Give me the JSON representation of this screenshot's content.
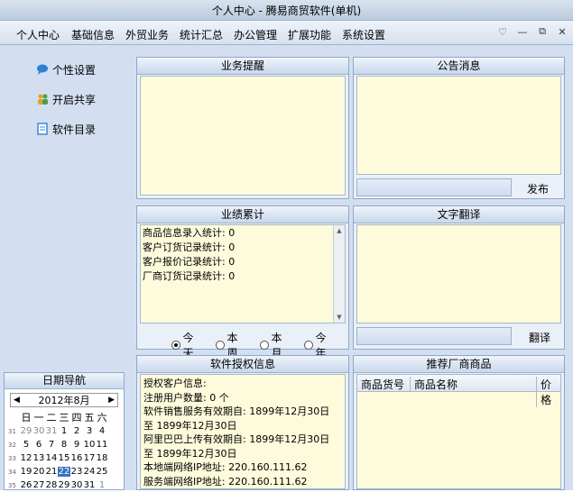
{
  "window": {
    "title": "个人中心 - 腾易商贸软件(单机)",
    "minimize": "—",
    "maximize": "▢",
    "close": "✕"
  },
  "menu": {
    "items": [
      "个人中心",
      "基础信息",
      "外贸业务",
      "统计汇总",
      "办公管理",
      "扩展功能",
      "系统设置"
    ],
    "right_icons": [
      "chevron-down-icon",
      "minimize-icon",
      "restore-icon",
      "close-icon"
    ],
    "right_glyphs": [
      "♡",
      "—",
      "⧉",
      "✕"
    ]
  },
  "sidebar": {
    "items": [
      {
        "label": "个性设置",
        "icon": "chat-bubble-icon",
        "color": "#2f7fd6"
      },
      {
        "label": "开启共享",
        "icon": "users-icon",
        "color": "#e3a32a"
      },
      {
        "label": "软件目录",
        "icon": "document-icon",
        "color": "#3a88d6"
      }
    ]
  },
  "panels": {
    "reminder": {
      "title": "业务提醒"
    },
    "notice": {
      "title": "公告消息",
      "publish_label": "发布"
    },
    "stats": {
      "title": "业绩累计",
      "lines": [
        "商品信息录入统计: 0",
        "客户订货记录统计: 0",
        "客户报价记录统计: 0",
        "厂商订货记录统计: 0"
      ],
      "radios": [
        {
          "label": "今天",
          "checked": true
        },
        {
          "label": "本周",
          "checked": false
        },
        {
          "label": "本月",
          "checked": false
        },
        {
          "label": "今年",
          "checked": false
        }
      ]
    },
    "translate": {
      "title": "文字翻译",
      "translate_label": "翻译"
    },
    "license": {
      "title": "软件授权信息",
      "lines": [
        "授权客户信息:",
        "注册用户数量: 0 个",
        "软件销售服务有效期自: 1899年12月30日 至 1899年12月30日",
        "阿里巴巴上传有效期自: 1899年12月30日 至 1899年12月30日",
        "本地端网络IP地址: 220.160.111.62",
        "服务端网络IP地址: 220.160.111.62"
      ]
    },
    "recommend": {
      "title": "推荐厂商商品",
      "columns": [
        "商品货号",
        "商品名称",
        "价格"
      ]
    }
  },
  "calendar": {
    "title": "日期导航",
    "month_label": "2012年8月",
    "prev": "◀",
    "next": "▶",
    "weekdays": [
      "日",
      "一",
      "二",
      "三",
      "四",
      "五",
      "六"
    ],
    "weeks": [
      {
        "wn": "31",
        "days": [
          "29",
          "30",
          "31",
          "1",
          "2",
          "3",
          "4"
        ],
        "gray": [
          0,
          1,
          2
        ]
      },
      {
        "wn": "32",
        "days": [
          "5",
          "6",
          "7",
          "8",
          "9",
          "10",
          "11"
        ],
        "gray": []
      },
      {
        "wn": "33",
        "days": [
          "12",
          "13",
          "14",
          "15",
          "16",
          "17",
          "18"
        ],
        "gray": []
      },
      {
        "wn": "34",
        "days": [
          "19",
          "20",
          "21",
          "22",
          "23",
          "24",
          "25"
        ],
        "gray": [],
        "selected": 3
      },
      {
        "wn": "35",
        "days": [
          "26",
          "27",
          "28",
          "29",
          "30",
          "31",
          "1"
        ],
        "gray": [
          6
        ]
      }
    ]
  }
}
